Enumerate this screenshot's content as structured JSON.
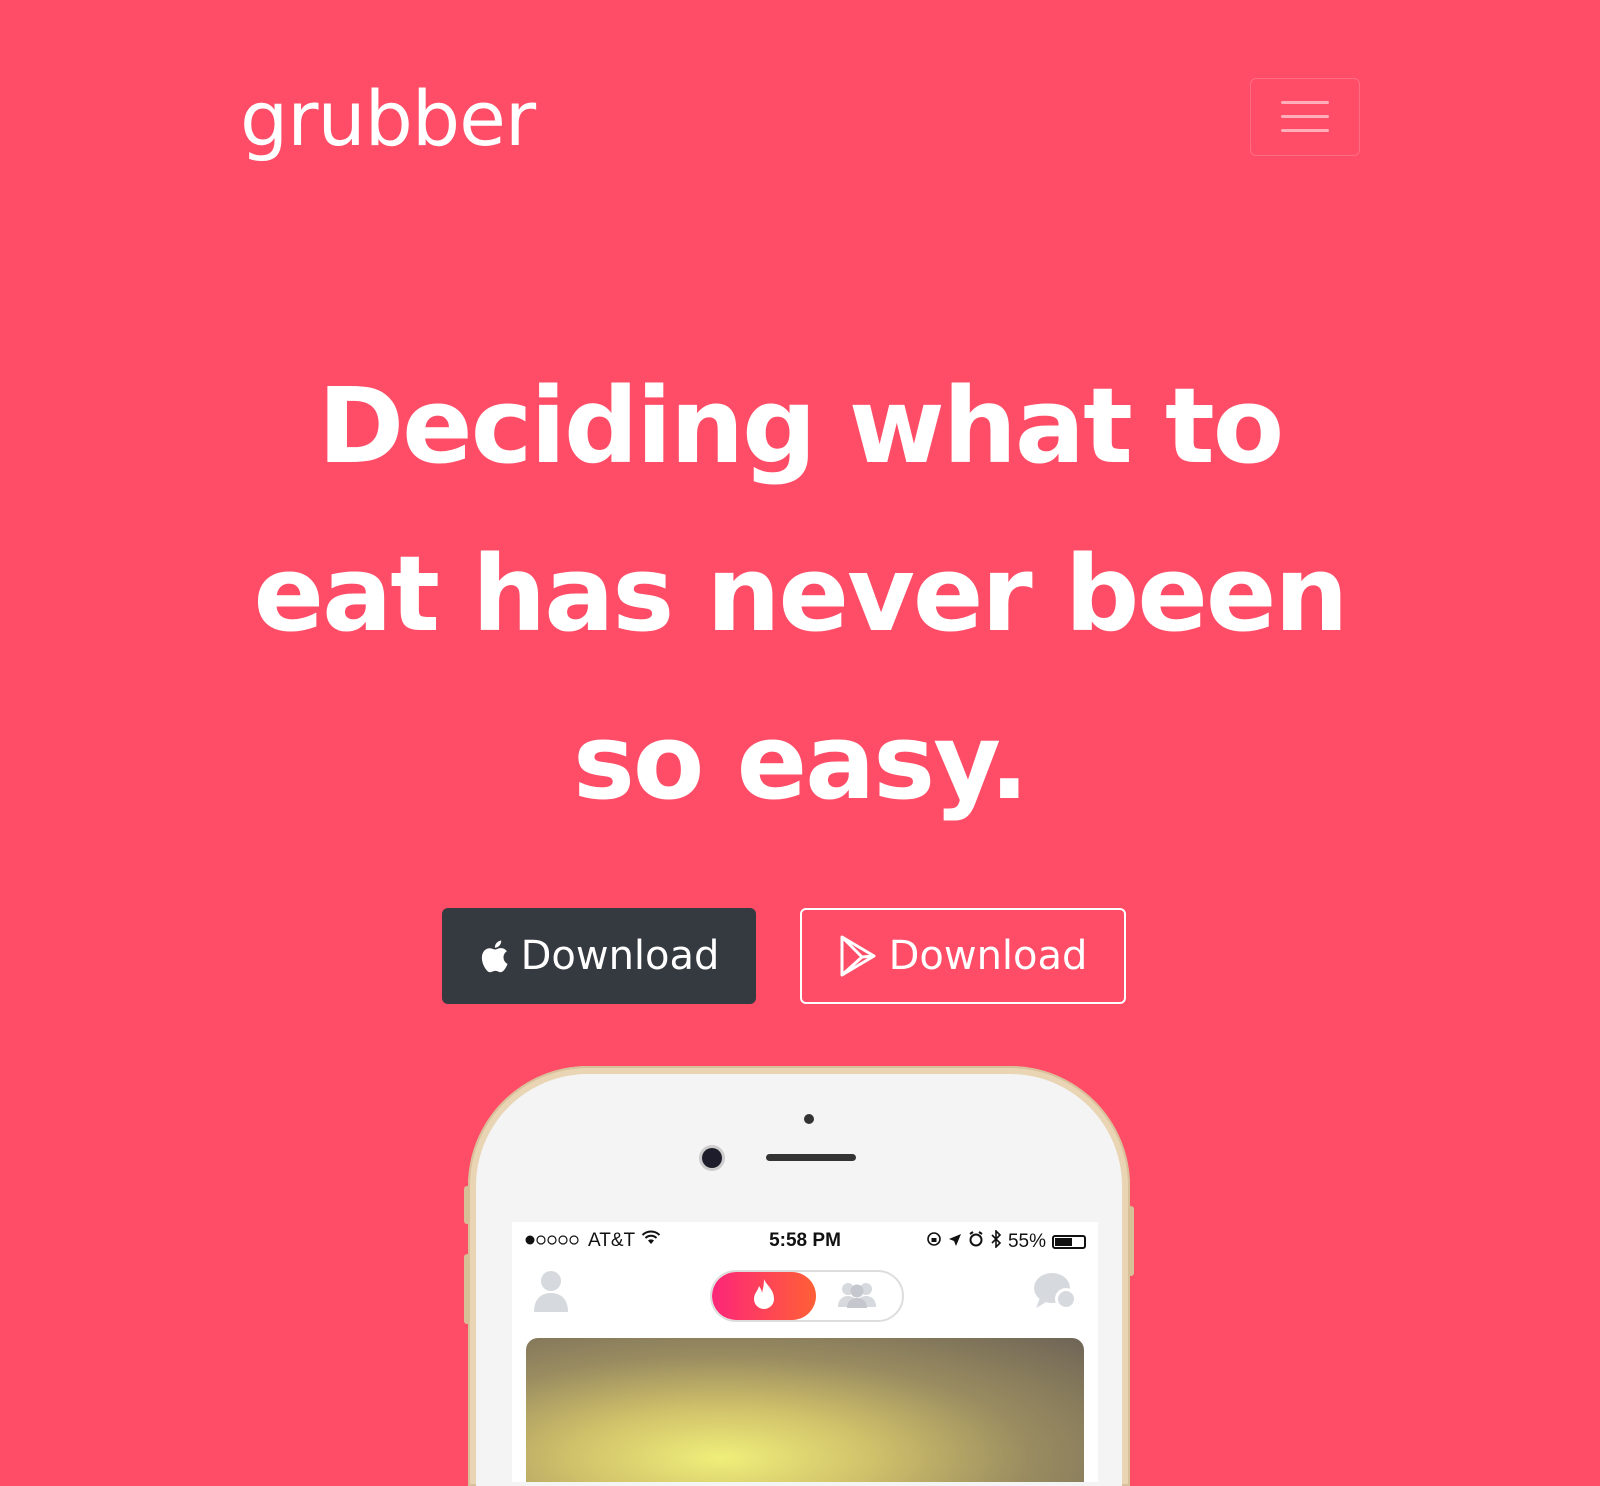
{
  "navbar": {
    "brand": "grubber",
    "menu_icon": "hamburger-icon"
  },
  "hero": {
    "headline": "Deciding what to eat has never been so easy."
  },
  "buttons": {
    "ios": {
      "label": "Download",
      "icon": "apple-icon",
      "bg": "#343a40"
    },
    "android": {
      "label": "Download",
      "icon": "play-store-icon"
    }
  },
  "phone": {
    "status_bar": {
      "carrier": "AT&T",
      "time": "5:58 PM",
      "battery_percent": "55%",
      "battery_level": 0.55
    },
    "icons": [
      "profile-icon",
      "flame-icon",
      "group-icon",
      "chat-icon"
    ]
  },
  "colors": {
    "background": "#ff4d67",
    "text": "#ffffff",
    "dark_button": "#343a40"
  }
}
